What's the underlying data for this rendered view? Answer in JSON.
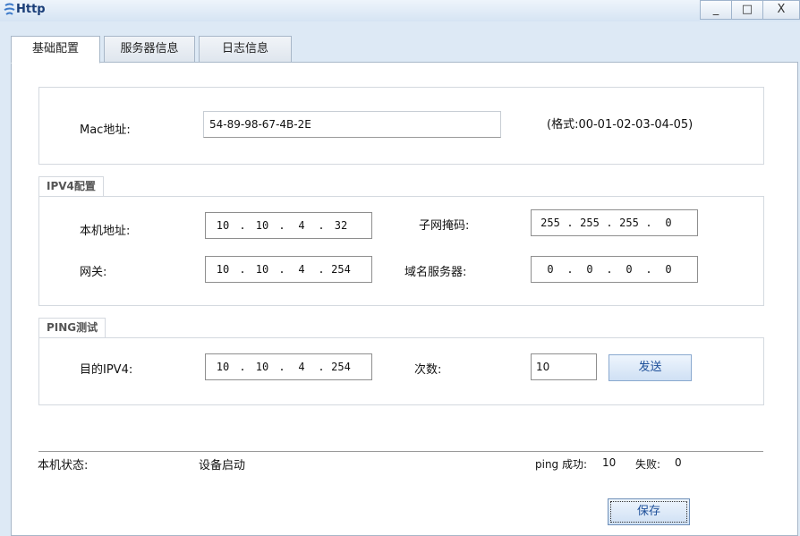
{
  "window": {
    "title": "Http",
    "minimize_label": "_",
    "maximize_label": "□",
    "close_label": "X"
  },
  "tabs": [
    {
      "label": "基础配置",
      "active": true
    },
    {
      "label": "服务器信息",
      "active": false
    },
    {
      "label": "日志信息",
      "active": false
    }
  ],
  "mac": {
    "label": "Mac地址:",
    "value": "54-89-98-67-4B-2E",
    "format_hint": "(格式:00-01-02-03-04-05)"
  },
  "ipv4": {
    "section_label": "IPV4配置",
    "local_address_label": "本机地址:",
    "local_address": [
      "10",
      "10",
      "4",
      "32"
    ],
    "subnet_mask_label": "子网掩码:",
    "subnet_mask": [
      "255",
      "255",
      "255",
      "0"
    ],
    "gateway_label": "网关:",
    "gateway": [
      "10",
      "10",
      "4",
      "254"
    ],
    "dns_label": "域名服务器:",
    "dns": [
      "0",
      "0",
      "0",
      "0"
    ]
  },
  "ping": {
    "section_label": "PING测试",
    "target_label": "目的IPV4:",
    "target": [
      "10",
      "10",
      "4",
      "254"
    ],
    "count_label": "次数:",
    "count": "10",
    "send_label": "发送"
  },
  "status": {
    "label": "本机状态:",
    "value": "设备启动",
    "ping_success_label": "ping 成功:",
    "ping_success_count": "10",
    "ping_fail_label": "失败:",
    "ping_fail_count": "0"
  },
  "save_label": "保存",
  "colors": {
    "window_bg": "#dde9f5",
    "title_text": "#1a3e78",
    "button_text": "#1d4f99"
  }
}
